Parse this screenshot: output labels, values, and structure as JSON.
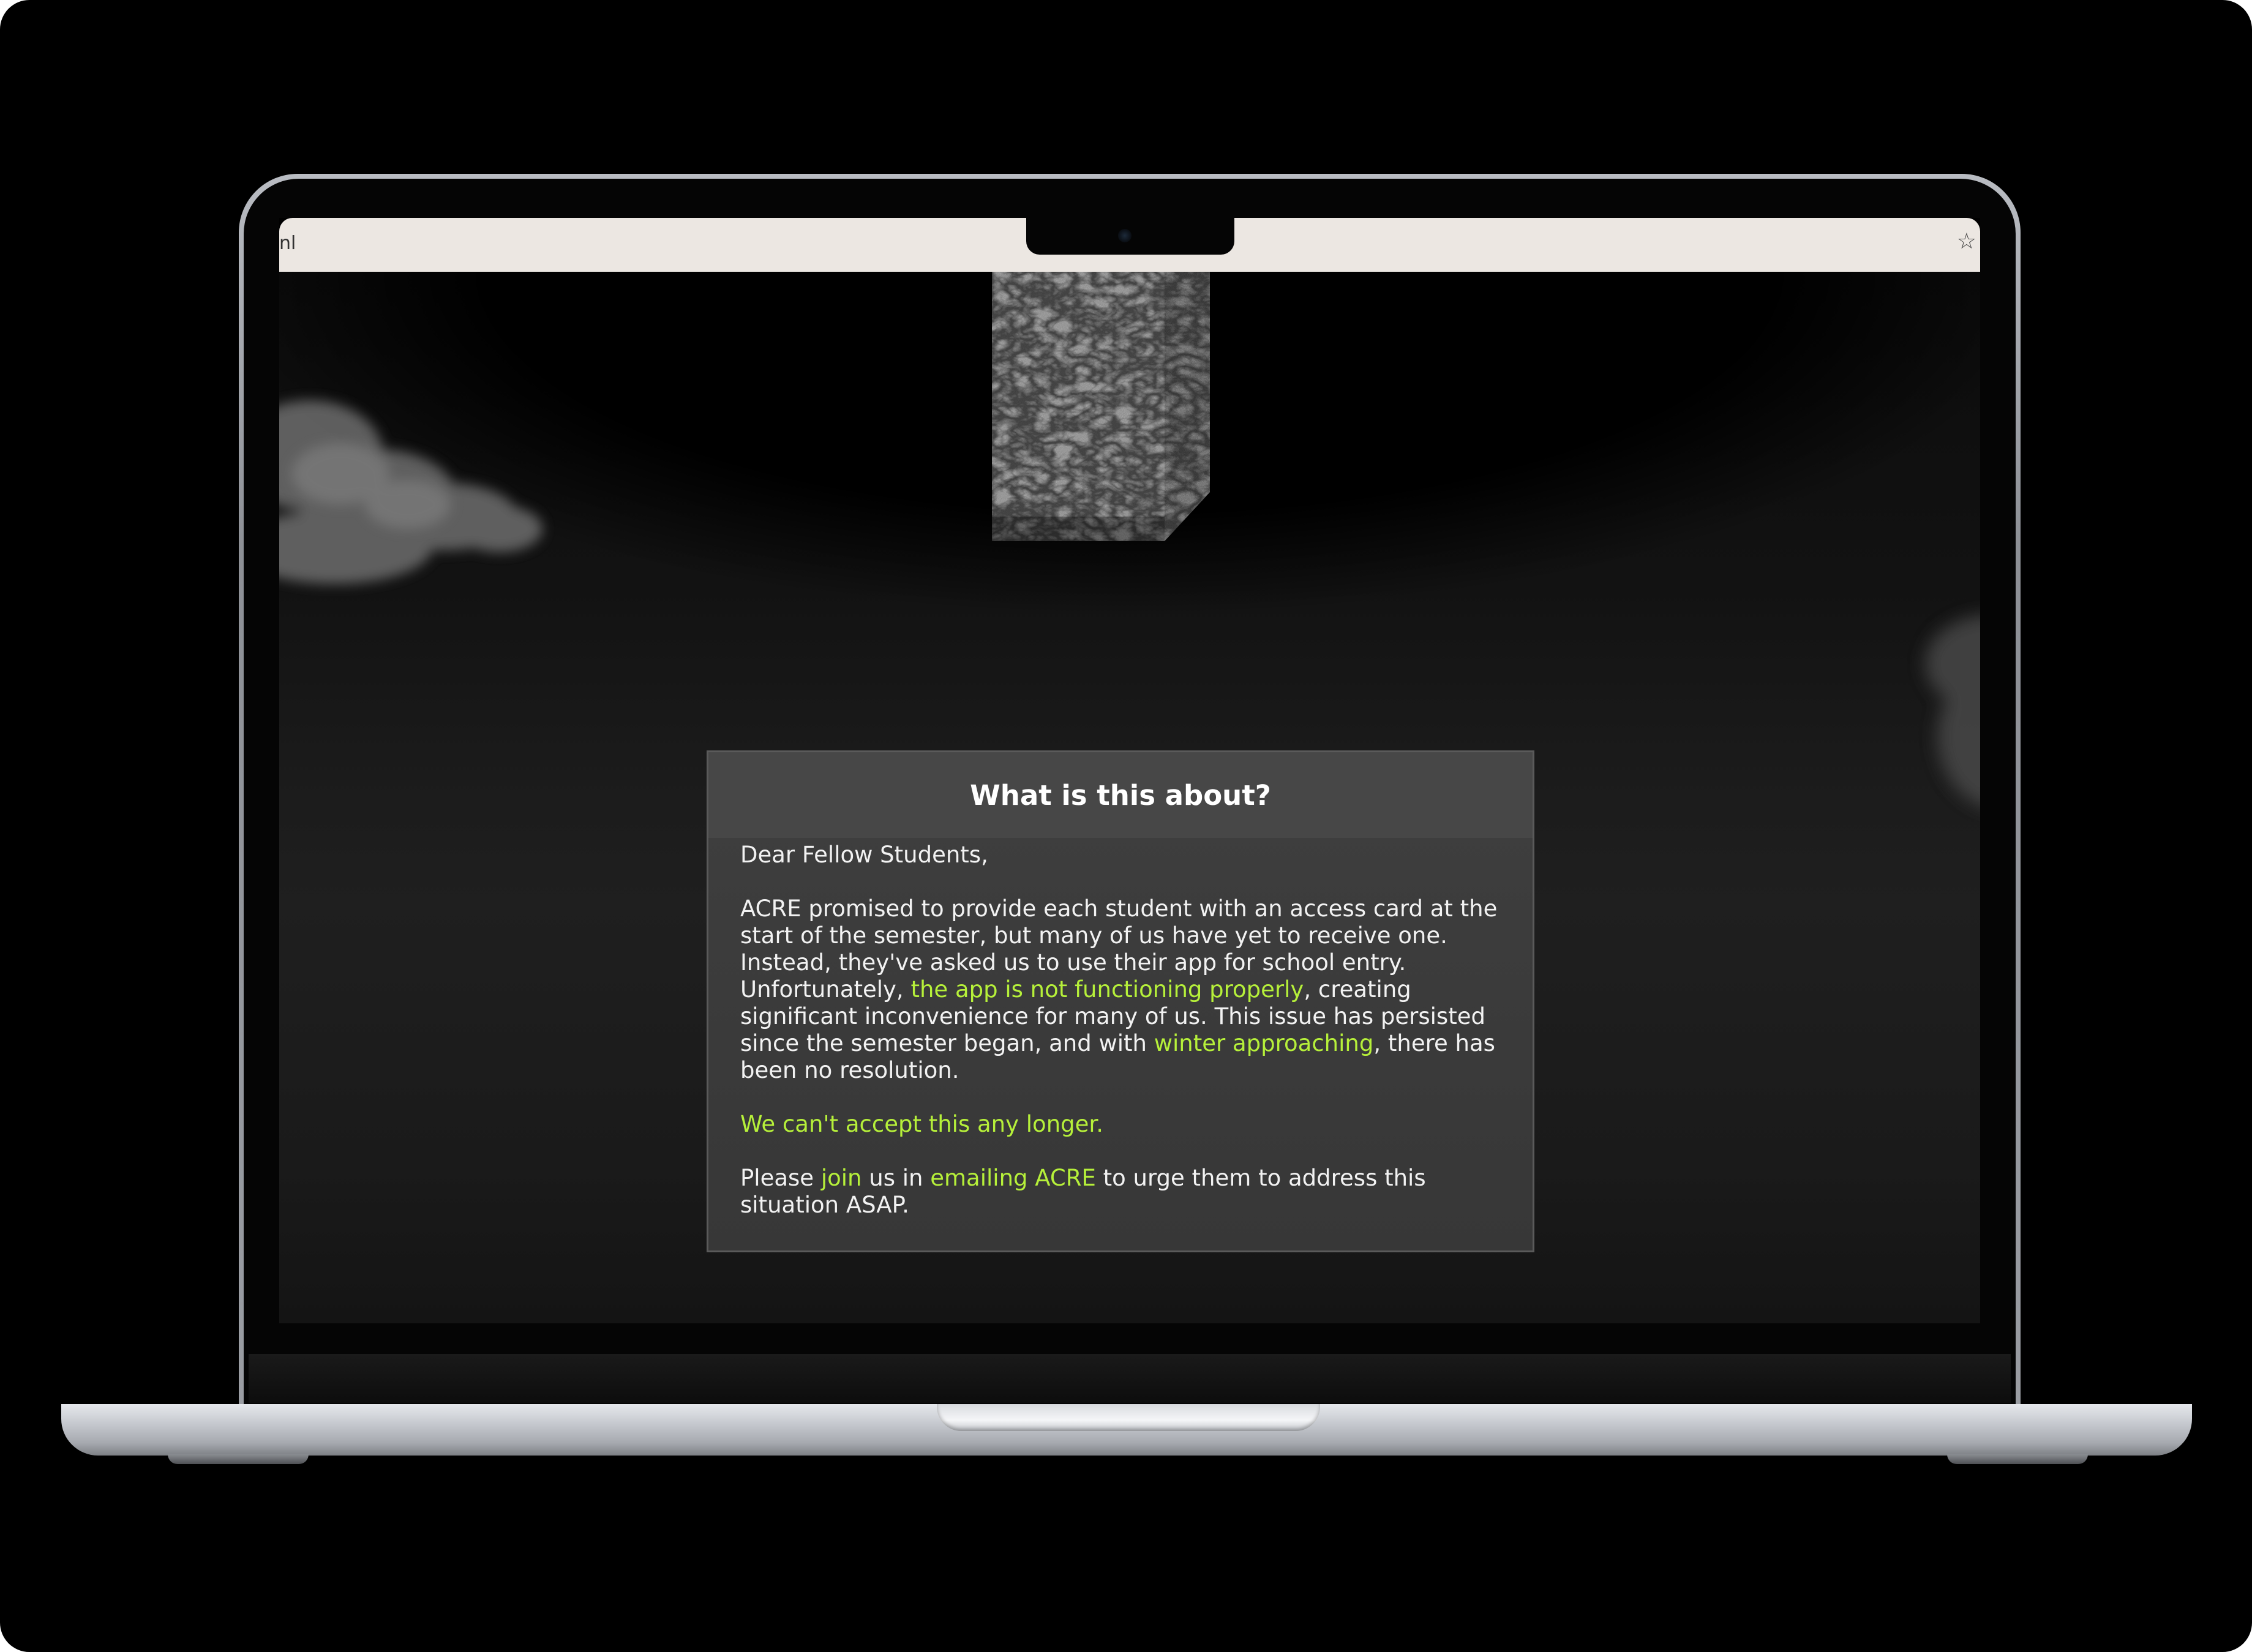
{
  "browser": {
    "url_fragment": "nl",
    "bookmark_icon": "star-icon"
  },
  "modal": {
    "title": "What is this about?",
    "greeting": "Dear Fellow Students,",
    "para1": {
      "part1": "ACRE promised to provide each student with an access card at the start of the semester, but many of us have yet to receive one. Instead, they've asked us to use their app for school entry. Unfortunately, ",
      "highlight1": "the app is not functioning properly",
      "part2": ", creating significant inconvenience for many of us. This issue has persisted since the semester began, and with ",
      "highlight2": "winter approaching",
      "part3": ", there has been no resolution."
    },
    "emphasis": "We can't accept this any longer.",
    "cta": {
      "part1": "Please ",
      "join_link": "join",
      "part2": " us in ",
      "email_link": "emailing ACRE",
      "part3": " to urge them to address this situation ASAP."
    }
  },
  "colors": {
    "accent": "#b6f03a",
    "modal_bg": "#3c3c3c",
    "modal_header": "#474747",
    "page_bg": "#000000",
    "browser_bar": "#ece7e2"
  }
}
